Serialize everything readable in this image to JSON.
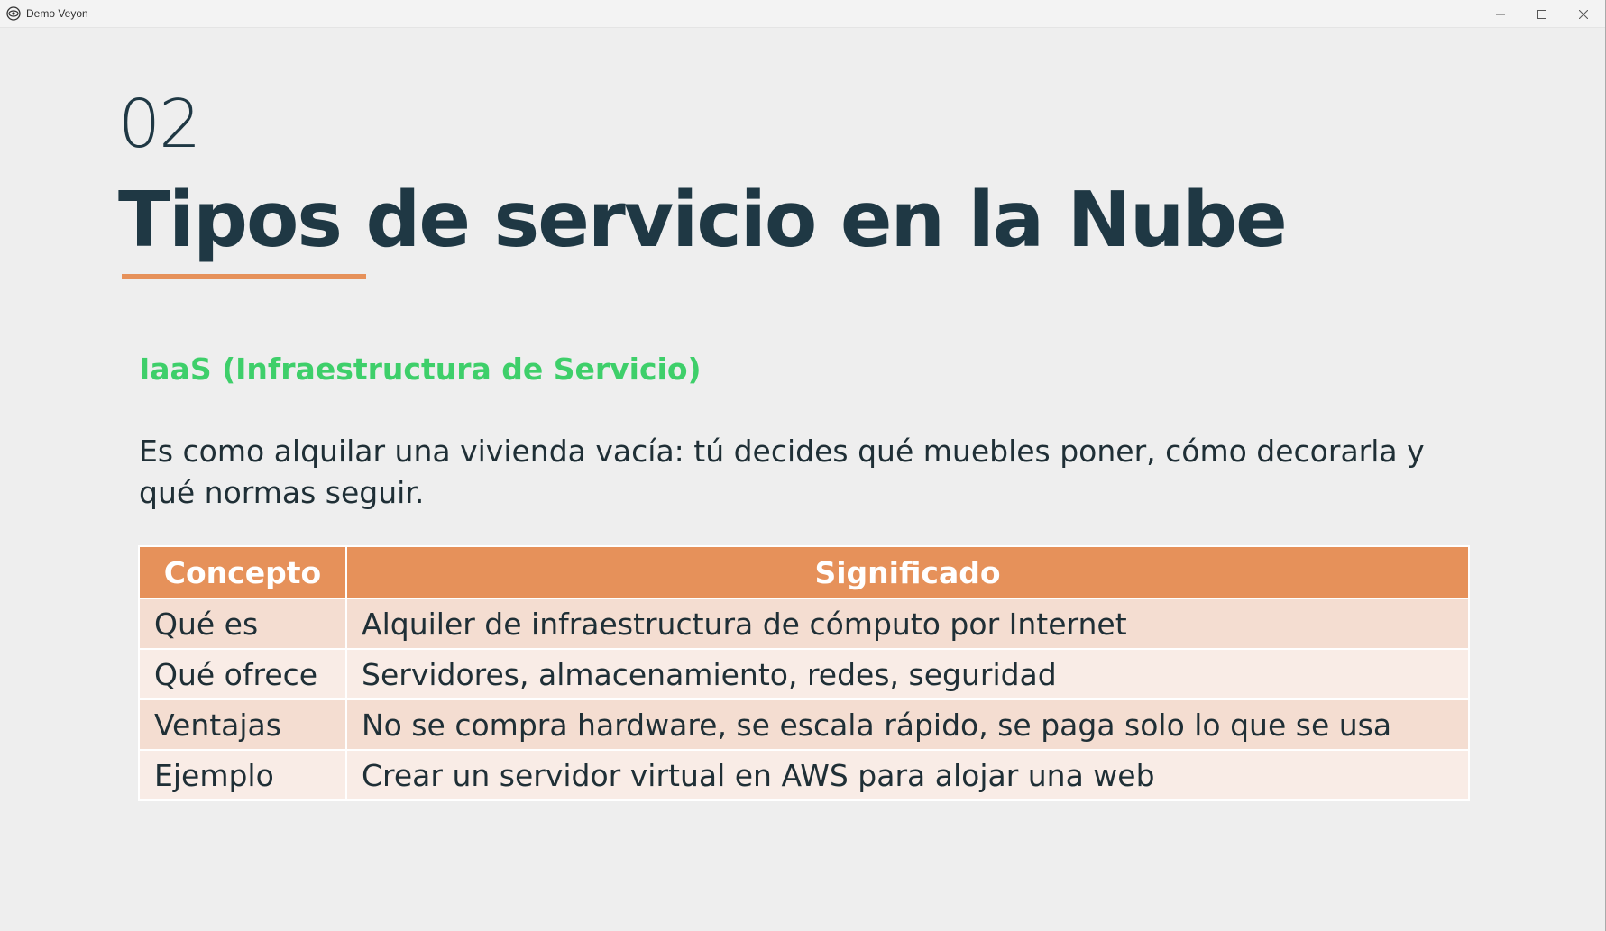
{
  "window": {
    "title": "Demo Veyon",
    "app_icon": "eye-icon",
    "controls": [
      "minimize-icon",
      "maximize-icon",
      "close-icon"
    ]
  },
  "slide": {
    "number": "02",
    "title": "Tipos de servicio en la Nube",
    "subtitle": "IaaS (Infraestructura de Servicio)",
    "description": "Es como alquilar una vivienda vacía: tú decides qué muebles poner, cómo decorarla y qué normas seguir.",
    "colors": {
      "title": "#1f3844",
      "accent_orange": "#e6915a",
      "subtitle_green": "#3ecf6a",
      "row_odd": "#f4ddd1",
      "row_even": "#f9ece6"
    },
    "table": {
      "headers": [
        "Concepto",
        "Significado"
      ],
      "rows": [
        {
          "concepto": "Qué es",
          "significado": "Alquiler de infraestructura de cómputo por Internet"
        },
        {
          "concepto": "Qué ofrece",
          "significado": "Servidores, almacenamiento, redes, seguridad"
        },
        {
          "concepto": "Ventajas",
          "significado": "No se compra hardware, se escala rápido, se paga solo lo que se usa"
        },
        {
          "concepto": "Ejemplo",
          "significado": "Crear un servidor virtual en AWS para alojar una web"
        }
      ]
    }
  }
}
